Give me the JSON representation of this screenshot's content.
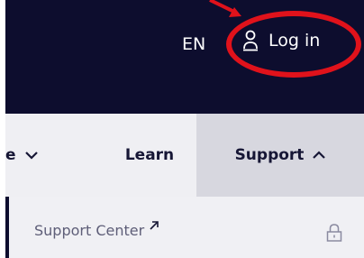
{
  "header": {
    "language": "EN",
    "login_label": "Log in",
    "icons": {
      "login": "user-icon"
    }
  },
  "nav": {
    "items": [
      {
        "label": "e",
        "icon": "chevron-down-icon"
      },
      {
        "label": "Learn"
      },
      {
        "label": "Support",
        "icon": "chevron-up-icon",
        "active": true
      }
    ]
  },
  "submenu": {
    "items": [
      {
        "label": "Support Center",
        "icon": "external-link-icon"
      }
    ],
    "lock_icon": "lock-icon"
  },
  "annotation": {
    "highlight": "Log in",
    "color": "#e0121b"
  },
  "colors": {
    "topbar": "#0d0d2e",
    "navbar": "#efeff3",
    "active_tab": "#d7d7df",
    "nav_text": "#161635",
    "submenu_text": "#5e5e78"
  }
}
